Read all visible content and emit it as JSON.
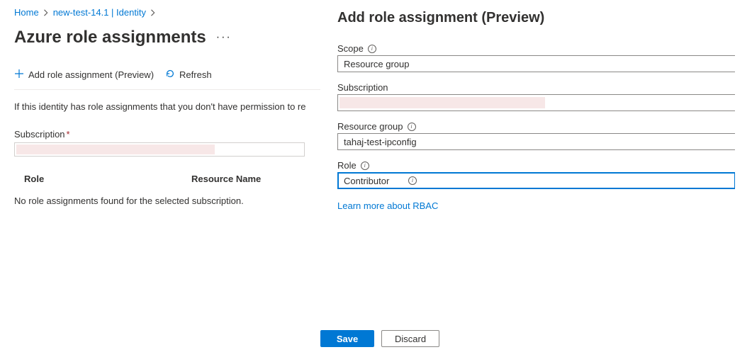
{
  "breadcrumb": {
    "home": "Home",
    "item": "new-test-14.1 | Identity"
  },
  "page": {
    "title": "Azure role assignments"
  },
  "commands": {
    "add": "Add role assignment (Preview)",
    "refresh": "Refresh"
  },
  "left": {
    "info": "If this identity has role assignments that you don't have permission to re",
    "subscription_label": "Subscription",
    "col_role": "Role",
    "col_resource": "Resource Name",
    "empty": "No role assignments found for the selected subscription."
  },
  "panel": {
    "title": "Add role assignment (Preview)",
    "scope_label": "Scope",
    "scope_value": "Resource group",
    "subscription_label": "Subscription",
    "rg_label": "Resource group",
    "rg_value": "tahaj-test-ipconfig",
    "role_label": "Role",
    "role_value": "Contributor",
    "learn_more": "Learn more about RBAC",
    "save": "Save",
    "discard": "Discard"
  }
}
